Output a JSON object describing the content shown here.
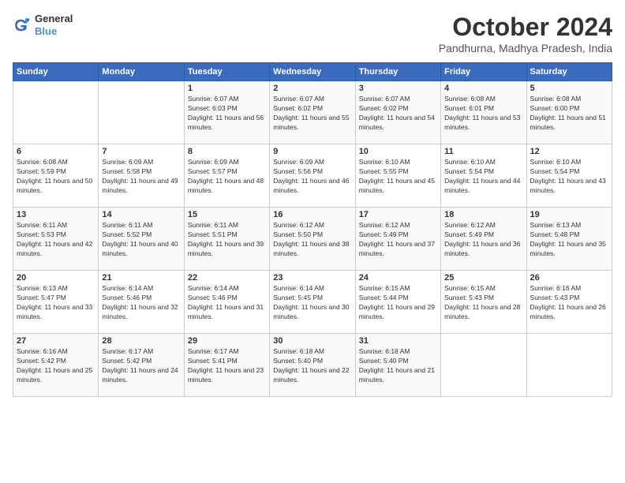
{
  "logo": {
    "line1": "General",
    "line2": "Blue"
  },
  "title": "October 2024",
  "location": "Pandhurna, Madhya Pradesh, India",
  "days_of_week": [
    "Sunday",
    "Monday",
    "Tuesday",
    "Wednesday",
    "Thursday",
    "Friday",
    "Saturday"
  ],
  "weeks": [
    [
      {
        "day": "",
        "sunrise": "",
        "sunset": "",
        "daylight": ""
      },
      {
        "day": "",
        "sunrise": "",
        "sunset": "",
        "daylight": ""
      },
      {
        "day": "1",
        "sunrise": "Sunrise: 6:07 AM",
        "sunset": "Sunset: 6:03 PM",
        "daylight": "Daylight: 11 hours and 56 minutes."
      },
      {
        "day": "2",
        "sunrise": "Sunrise: 6:07 AM",
        "sunset": "Sunset: 6:02 PM",
        "daylight": "Daylight: 11 hours and 55 minutes."
      },
      {
        "day": "3",
        "sunrise": "Sunrise: 6:07 AM",
        "sunset": "Sunset: 6:02 PM",
        "daylight": "Daylight: 11 hours and 54 minutes."
      },
      {
        "day": "4",
        "sunrise": "Sunrise: 6:08 AM",
        "sunset": "Sunset: 6:01 PM",
        "daylight": "Daylight: 11 hours and 53 minutes."
      },
      {
        "day": "5",
        "sunrise": "Sunrise: 6:08 AM",
        "sunset": "Sunset: 6:00 PM",
        "daylight": "Daylight: 11 hours and 51 minutes."
      }
    ],
    [
      {
        "day": "6",
        "sunrise": "Sunrise: 6:08 AM",
        "sunset": "Sunset: 5:59 PM",
        "daylight": "Daylight: 11 hours and 50 minutes."
      },
      {
        "day": "7",
        "sunrise": "Sunrise: 6:09 AM",
        "sunset": "Sunset: 5:58 PM",
        "daylight": "Daylight: 11 hours and 49 minutes."
      },
      {
        "day": "8",
        "sunrise": "Sunrise: 6:09 AM",
        "sunset": "Sunset: 5:57 PM",
        "daylight": "Daylight: 11 hours and 48 minutes."
      },
      {
        "day": "9",
        "sunrise": "Sunrise: 6:09 AM",
        "sunset": "Sunset: 5:56 PM",
        "daylight": "Daylight: 11 hours and 46 minutes."
      },
      {
        "day": "10",
        "sunrise": "Sunrise: 6:10 AM",
        "sunset": "Sunset: 5:55 PM",
        "daylight": "Daylight: 11 hours and 45 minutes."
      },
      {
        "day": "11",
        "sunrise": "Sunrise: 6:10 AM",
        "sunset": "Sunset: 5:54 PM",
        "daylight": "Daylight: 11 hours and 44 minutes."
      },
      {
        "day": "12",
        "sunrise": "Sunrise: 6:10 AM",
        "sunset": "Sunset: 5:54 PM",
        "daylight": "Daylight: 11 hours and 43 minutes."
      }
    ],
    [
      {
        "day": "13",
        "sunrise": "Sunrise: 6:11 AM",
        "sunset": "Sunset: 5:53 PM",
        "daylight": "Daylight: 11 hours and 42 minutes."
      },
      {
        "day": "14",
        "sunrise": "Sunrise: 6:11 AM",
        "sunset": "Sunset: 5:52 PM",
        "daylight": "Daylight: 11 hours and 40 minutes."
      },
      {
        "day": "15",
        "sunrise": "Sunrise: 6:11 AM",
        "sunset": "Sunset: 5:51 PM",
        "daylight": "Daylight: 11 hours and 39 minutes."
      },
      {
        "day": "16",
        "sunrise": "Sunrise: 6:12 AM",
        "sunset": "Sunset: 5:50 PM",
        "daylight": "Daylight: 11 hours and 38 minutes."
      },
      {
        "day": "17",
        "sunrise": "Sunrise: 6:12 AM",
        "sunset": "Sunset: 5:49 PM",
        "daylight": "Daylight: 11 hours and 37 minutes."
      },
      {
        "day": "18",
        "sunrise": "Sunrise: 6:12 AM",
        "sunset": "Sunset: 5:49 PM",
        "daylight": "Daylight: 11 hours and 36 minutes."
      },
      {
        "day": "19",
        "sunrise": "Sunrise: 6:13 AM",
        "sunset": "Sunset: 5:48 PM",
        "daylight": "Daylight: 11 hours and 35 minutes."
      }
    ],
    [
      {
        "day": "20",
        "sunrise": "Sunrise: 6:13 AM",
        "sunset": "Sunset: 5:47 PM",
        "daylight": "Daylight: 11 hours and 33 minutes."
      },
      {
        "day": "21",
        "sunrise": "Sunrise: 6:14 AM",
        "sunset": "Sunset: 5:46 PM",
        "daylight": "Daylight: 11 hours and 32 minutes."
      },
      {
        "day": "22",
        "sunrise": "Sunrise: 6:14 AM",
        "sunset": "Sunset: 5:46 PM",
        "daylight": "Daylight: 11 hours and 31 minutes."
      },
      {
        "day": "23",
        "sunrise": "Sunrise: 6:14 AM",
        "sunset": "Sunset: 5:45 PM",
        "daylight": "Daylight: 11 hours and 30 minutes."
      },
      {
        "day": "24",
        "sunrise": "Sunrise: 6:15 AM",
        "sunset": "Sunset: 5:44 PM",
        "daylight": "Daylight: 11 hours and 29 minutes."
      },
      {
        "day": "25",
        "sunrise": "Sunrise: 6:15 AM",
        "sunset": "Sunset: 5:43 PM",
        "daylight": "Daylight: 11 hours and 28 minutes."
      },
      {
        "day": "26",
        "sunrise": "Sunrise: 6:16 AM",
        "sunset": "Sunset: 5:43 PM",
        "daylight": "Daylight: 11 hours and 26 minutes."
      }
    ],
    [
      {
        "day": "27",
        "sunrise": "Sunrise: 6:16 AM",
        "sunset": "Sunset: 5:42 PM",
        "daylight": "Daylight: 11 hours and 25 minutes."
      },
      {
        "day": "28",
        "sunrise": "Sunrise: 6:17 AM",
        "sunset": "Sunset: 5:42 PM",
        "daylight": "Daylight: 11 hours and 24 minutes."
      },
      {
        "day": "29",
        "sunrise": "Sunrise: 6:17 AM",
        "sunset": "Sunset: 5:41 PM",
        "daylight": "Daylight: 11 hours and 23 minutes."
      },
      {
        "day": "30",
        "sunrise": "Sunrise: 6:18 AM",
        "sunset": "Sunset: 5:40 PM",
        "daylight": "Daylight: 11 hours and 22 minutes."
      },
      {
        "day": "31",
        "sunrise": "Sunrise: 6:18 AM",
        "sunset": "Sunset: 5:40 PM",
        "daylight": "Daylight: 11 hours and 21 minutes."
      },
      {
        "day": "",
        "sunrise": "",
        "sunset": "",
        "daylight": ""
      },
      {
        "day": "",
        "sunrise": "",
        "sunset": "",
        "daylight": ""
      }
    ]
  ]
}
